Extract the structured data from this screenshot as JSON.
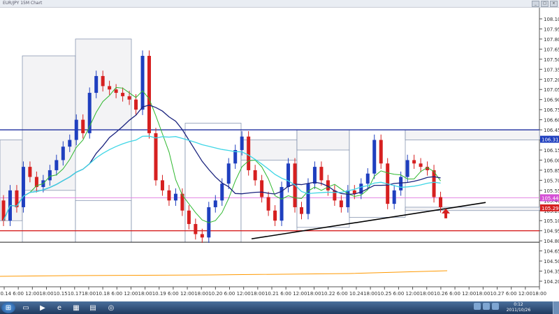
{
  "window": {
    "title": "EUR/JPY 15M Chart",
    "buttons": [
      "_",
      "□",
      "×"
    ]
  },
  "chart_data": {
    "type": "candlestick",
    "symbol": "EUR/JPY",
    "y_ticks": [
      "108.10",
      "107.95",
      "107.80",
      "107.65",
      "107.50",
      "107.35",
      "107.20",
      "107.05",
      "106.90",
      "106.75",
      "106.60",
      "106.45",
      "106.30",
      "106.15",
      "106.00",
      "105.85",
      "105.70",
      "105.55",
      "105.40",
      "105.25",
      "105.10",
      "104.95",
      "104.80",
      "104.65",
      "104.50",
      "104.35",
      "104.20"
    ],
    "x_ticks": [
      "10.14",
      "6:00",
      "12:00",
      "18:00",
      "10.15",
      "10.17",
      "18:00",
      "10.18",
      "6:00",
      "12:00",
      "18:00",
      "10.19",
      "6:00",
      "12:00",
      "18:00",
      "10.20",
      "6:00",
      "12:00",
      "18:00",
      "10.21",
      "6:00",
      "12:00",
      "18:00",
      "10.22",
      "6:00",
      "10.24",
      "18:00",
      "10.25",
      "6:00",
      "12:00",
      "18:00",
      "10.26",
      "6:00",
      "12:00",
      "18:00",
      "10.27",
      "6:00",
      "12:00",
      "18:00"
    ],
    "price_badges": {
      "upper": "106.31",
      "mid": "105.44",
      "lower": "105.29"
    },
    "levels": {
      "resistance": 106.45,
      "support": 104.95,
      "floor": 104.78
    },
    "closes": [
      105.1,
      105.55,
      105.3,
      105.9,
      105.75,
      105.6,
      105.7,
      105.85,
      106.0,
      106.2,
      106.3,
      106.6,
      106.4,
      107.0,
      107.25,
      107.1,
      107.05,
      107.0,
      106.95,
      106.9,
      106.75,
      107.55,
      106.4,
      105.7,
      105.55,
      105.4,
      105.5,
      105.25,
      105.05,
      104.9,
      104.85,
      105.3,
      105.4,
      105.65,
      105.95,
      106.15,
      106.35,
      105.85,
      105.7,
      105.45,
      105.25,
      105.1,
      105.6,
      105.95,
      105.3,
      105.2,
      105.65,
      105.9,
      105.7,
      105.55,
      105.4,
      105.3,
      105.55,
      105.5,
      105.65,
      105.8,
      106.3,
      105.95,
      105.35,
      105.55,
      105.75,
      106.0,
      105.95,
      105.9,
      105.85,
      105.45,
      105.3
    ],
    "arrow": "up"
  },
  "taskbar": {
    "time": "0:12",
    "date": "2011/10/26"
  }
}
